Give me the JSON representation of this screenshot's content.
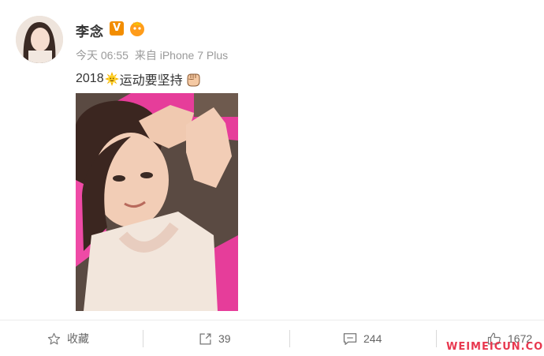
{
  "user": {
    "name": "李念",
    "verified_badge": "V"
  },
  "meta": {
    "time": "今天 06:55",
    "source": "来自 iPhone 7 Plus"
  },
  "post": {
    "text_prefix": "2018",
    "text_main": "运动要坚持"
  },
  "actions": {
    "favorite": "收藏",
    "repost_count": "39",
    "comment_count": "244",
    "like_count": "1672"
  },
  "watermark": "WEIMEICUN.COM",
  "colors": {
    "verified": "#f28d00",
    "photo_bg": "#f04aa8",
    "watermark": "#e8384f"
  }
}
